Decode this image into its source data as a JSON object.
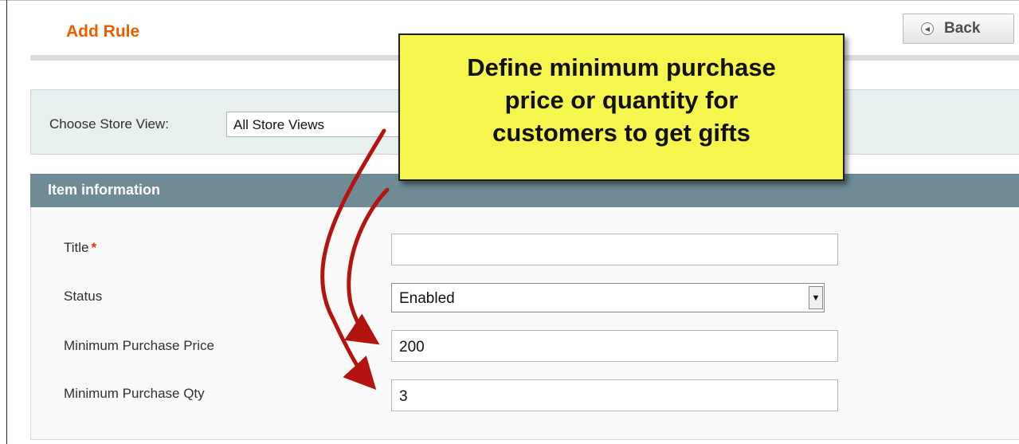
{
  "header": {
    "title": "Add Rule",
    "back_label": "Back",
    "back_icon": "circle-left-arrow"
  },
  "store": {
    "label": "Choose Store View:",
    "selected": "All Store Views"
  },
  "section": {
    "title": "Item information"
  },
  "form": {
    "title_label": "Title",
    "required_mark": "*",
    "title_value": "",
    "status_label": "Status",
    "status_value": "Enabled",
    "min_price_label": "Minimum Purchase Price",
    "min_price_value": "200",
    "min_qty_label": "Minimum Purchase Qty",
    "min_qty_value": "3"
  },
  "callout": {
    "line1": "Define minimum purchase",
    "line2": "price or quantity for",
    "line3": "customers to get gifts"
  },
  "colors": {
    "title": "#eb5e00",
    "section_header": "#6e8b96",
    "store_box": "#e7efef",
    "callout": "#f5f54d",
    "arrow": "#b3140f",
    "required": "#eb340a"
  }
}
